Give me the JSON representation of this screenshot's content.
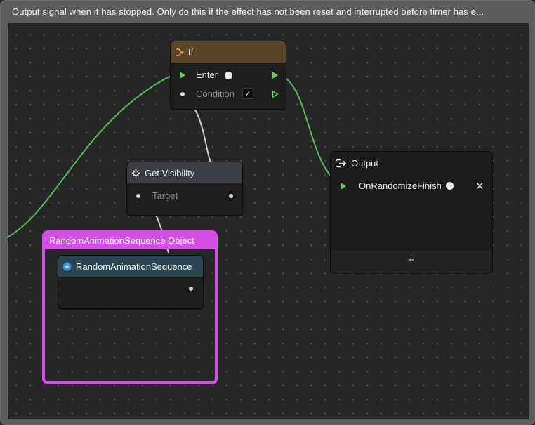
{
  "frame": {
    "title": "Output  signal when it has stopped. Only do this if the effect has not been reset and interrupted before timer has e..."
  },
  "nodes": {
    "if_node": {
      "title": "If",
      "icon": "branch-icon",
      "header_color": "#5a4528",
      "rows": {
        "enter": "Enter",
        "condition": "Condition"
      },
      "condition_checked": "✓"
    },
    "get_visibility": {
      "title": "Get Visibility",
      "icon": "gear-icon",
      "header_color": "#3a3d42",
      "rows": {
        "target": "Target"
      }
    },
    "output": {
      "title": "Output",
      "icon": "output-arrow-icon",
      "rows": {
        "signal": "OnRandomizeFinish"
      },
      "remove_label": "✕",
      "add_label": "+"
    },
    "random_seq": {
      "title": "RandomAnimationSequence",
      "icon": "plus-circle-icon",
      "header_color": "#2a4550"
    }
  },
  "group": {
    "title": "RandomAnimationSequence Object",
    "color": "#d44fe6"
  },
  "colors": {
    "exec_wire": "#53bf53",
    "data_wire": "#cfcfcf",
    "canvas": "#262626"
  }
}
